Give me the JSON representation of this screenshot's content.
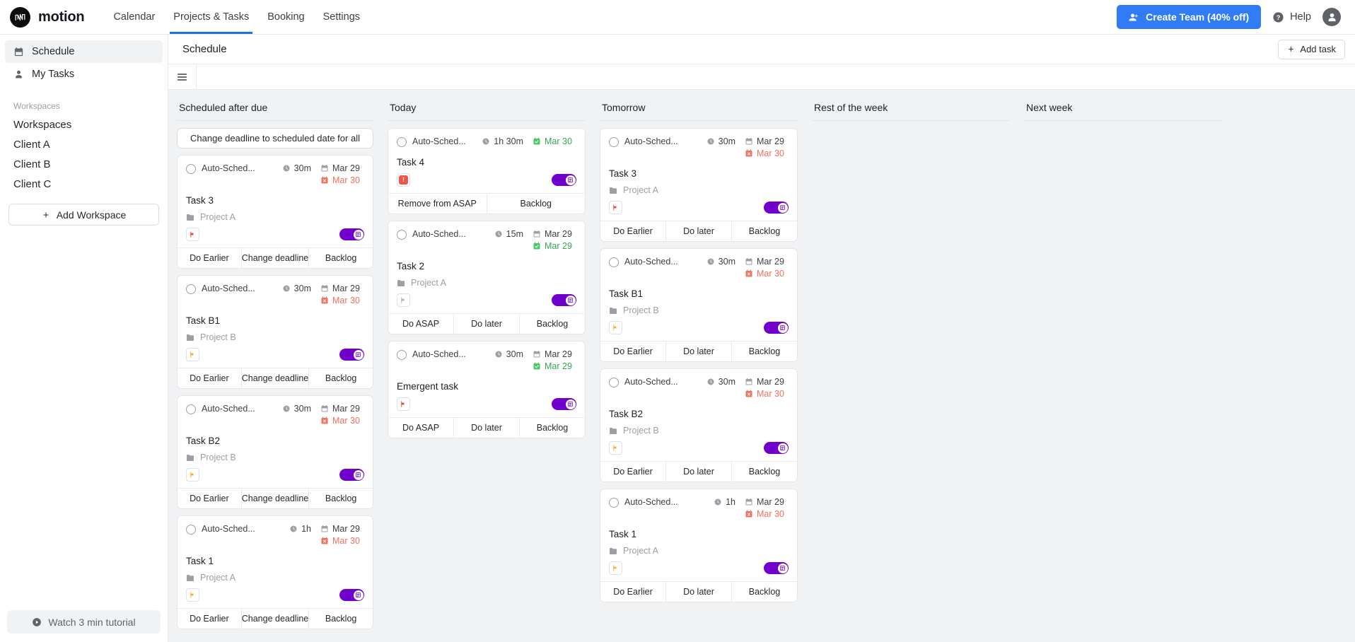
{
  "nav": {
    "brand": "motion",
    "tabs": [
      {
        "label": "Calendar",
        "active": false
      },
      {
        "label": "Projects & Tasks",
        "active": true
      },
      {
        "label": "Booking",
        "active": false
      },
      {
        "label": "Settings",
        "active": false
      }
    ],
    "create_team_label": "Create Team (40% off)",
    "help_label": "Help",
    "accent_blue": "#2f7cf6"
  },
  "sidebar": {
    "items": [
      {
        "label": "Schedule",
        "icon": "calendar-icon",
        "active": true
      },
      {
        "label": "My Tasks",
        "icon": "person-icon",
        "active": false
      }
    ],
    "section_label": "Workspaces",
    "workspaces": [
      "Workspaces",
      "Client A",
      "Client B",
      "Client C"
    ],
    "add_workspace_label": "Add Workspace",
    "tutorial_label": "Watch 3 min tutorial"
  },
  "page": {
    "title": "Schedule",
    "add_task_label": "Add task"
  },
  "columns": [
    {
      "title": "Scheduled after due",
      "bulk_action": "Change deadline to scheduled date for all",
      "cards": [
        {
          "autosched": "Auto-Sched...",
          "duration": "30m",
          "date_primary": "Mar 29",
          "date_primary_state": "plain",
          "date_secondary": "Mar 30",
          "date_secondary_state": "late",
          "title": "Task 3",
          "project": "Project A",
          "flag": "red",
          "toggle_on": true,
          "actions": [
            "Do Earlier",
            "Change deadline",
            "Backlog"
          ]
        },
        {
          "autosched": "Auto-Sched...",
          "duration": "30m",
          "date_primary": "Mar 29",
          "date_primary_state": "plain",
          "date_secondary": "Mar 30",
          "date_secondary_state": "late",
          "title": "Task B1",
          "project": "Project B",
          "flag": "orange",
          "toggle_on": true,
          "actions": [
            "Do Earlier",
            "Change deadline",
            "Backlog"
          ]
        },
        {
          "autosched": "Auto-Sched...",
          "duration": "30m",
          "date_primary": "Mar 29",
          "date_primary_state": "plain",
          "date_secondary": "Mar 30",
          "date_secondary_state": "late",
          "title": "Task B2",
          "project": "Project B",
          "flag": "orange",
          "toggle_on": true,
          "actions": [
            "Do Earlier",
            "Change deadline",
            "Backlog"
          ]
        },
        {
          "autosched": "Auto-Sched...",
          "duration": "1h",
          "date_primary": "Mar 29",
          "date_primary_state": "plain",
          "date_secondary": "Mar 30",
          "date_secondary_state": "late",
          "title": "Task 1",
          "project": "Project A",
          "flag": "orange",
          "toggle_on": true,
          "actions": [
            "Do Earlier",
            "Change deadline",
            "Backlog"
          ]
        }
      ]
    },
    {
      "title": "Today",
      "bulk_action": null,
      "cards": [
        {
          "autosched": "Auto-Sched...",
          "duration": "1h 30m",
          "date_primary": "Mar 30",
          "date_primary_state": "ok",
          "date_secondary": null,
          "date_secondary_state": null,
          "title": "Task 4",
          "project": null,
          "flag": "asap",
          "toggle_on": true,
          "actions": [
            "Remove from ASAP",
            "Backlog"
          ]
        },
        {
          "autosched": "Auto-Sched...",
          "duration": "15m",
          "date_primary": "Mar 29",
          "date_primary_state": "plain",
          "date_secondary": "Mar 29",
          "date_secondary_state": "ok",
          "title": "Task 2",
          "project": "Project A",
          "flag": "gray",
          "toggle_on": true,
          "actions": [
            "Do ASAP",
            "Do later",
            "Backlog"
          ]
        },
        {
          "autosched": "Auto-Sched...",
          "duration": "30m",
          "date_primary": "Mar 29",
          "date_primary_state": "plain",
          "date_secondary": "Mar 29",
          "date_secondary_state": "ok",
          "title": "Emergent task",
          "project": null,
          "flag": "red",
          "toggle_on": true,
          "actions": [
            "Do ASAP",
            "Do later",
            "Backlog"
          ]
        }
      ]
    },
    {
      "title": "Tomorrow",
      "bulk_action": null,
      "cards": [
        {
          "autosched": "Auto-Sched...",
          "duration": "30m",
          "date_primary": "Mar 29",
          "date_primary_state": "plain",
          "date_secondary": "Mar 30",
          "date_secondary_state": "late",
          "title": "Task 3",
          "project": "Project A",
          "flag": "red",
          "toggle_on": true,
          "actions": [
            "Do Earlier",
            "Do later",
            "Backlog"
          ]
        },
        {
          "autosched": "Auto-Sched...",
          "duration": "30m",
          "date_primary": "Mar 29",
          "date_primary_state": "plain",
          "date_secondary": "Mar 30",
          "date_secondary_state": "late",
          "title": "Task B1",
          "project": "Project B",
          "flag": "orange",
          "toggle_on": true,
          "actions": [
            "Do Earlier",
            "Do later",
            "Backlog"
          ]
        },
        {
          "autosched": "Auto-Sched...",
          "duration": "30m",
          "date_primary": "Mar 29",
          "date_primary_state": "plain",
          "date_secondary": "Mar 30",
          "date_secondary_state": "late",
          "title": "Task B2",
          "project": "Project B",
          "flag": "orange",
          "toggle_on": true,
          "actions": [
            "Do Earlier",
            "Do later",
            "Backlog"
          ]
        },
        {
          "autosched": "Auto-Sched...",
          "duration": "1h",
          "date_primary": "Mar 29",
          "date_primary_state": "plain",
          "date_secondary": "Mar 30",
          "date_secondary_state": "late",
          "title": "Task 1",
          "project": "Project A",
          "flag": "orange",
          "toggle_on": true,
          "actions": [
            "Do Earlier",
            "Do later",
            "Backlog"
          ]
        }
      ]
    },
    {
      "title": "Rest of the week",
      "bulk_action": null,
      "cards": []
    },
    {
      "title": "Next week",
      "bulk_action": null,
      "cards": []
    }
  ],
  "colors": {
    "toggle_purple": "#7200cc",
    "flag_red": "#f2422b",
    "flag_orange": "#fbab35",
    "flag_gray": "#aeb0b5",
    "late_red": "#f2705e",
    "ok_green": "#34a853"
  }
}
